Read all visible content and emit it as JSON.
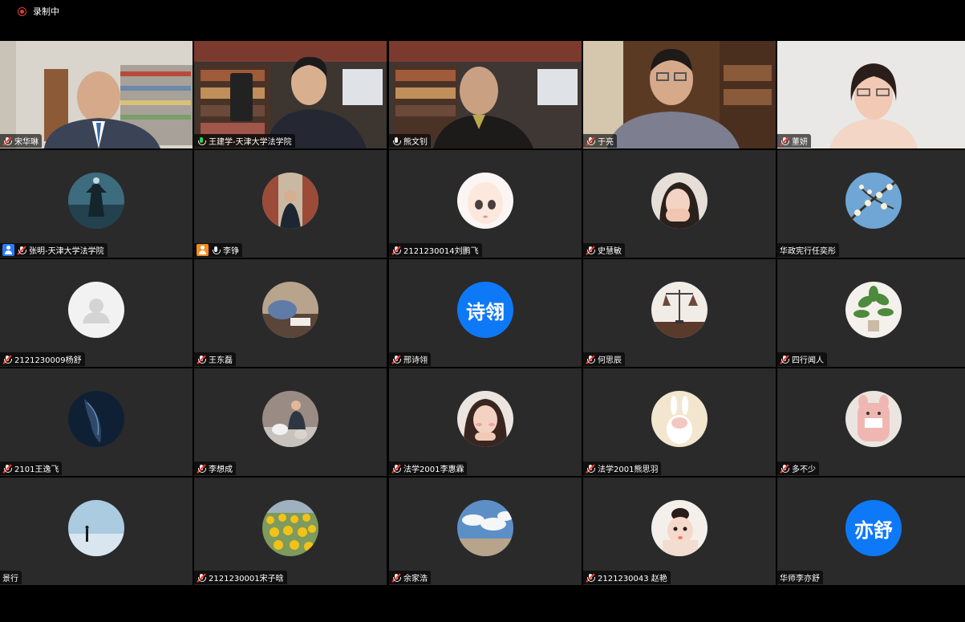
{
  "recording": {
    "label": "录制中"
  },
  "participants": [
    {
      "name": "宋华琳"
    },
    {
      "name": "王建学-天津大学法学院"
    },
    {
      "name": "熊文钊"
    },
    {
      "name": "于亮"
    },
    {
      "name": "董妍"
    },
    {
      "name": "张明-天津大学法学院"
    },
    {
      "name": "李铮"
    },
    {
      "name": "2121230014刘鹏飞"
    },
    {
      "name": "史慧敏"
    },
    {
      "name": "华政宪行任奕彤"
    },
    {
      "name": "2121230009杨舒"
    },
    {
      "name": "王东磊"
    },
    {
      "name": "邢诗翎",
      "avatar_text": "诗翎"
    },
    {
      "name": "何思辰"
    },
    {
      "name": "四行闻人"
    },
    {
      "name": "2101王逸飞"
    },
    {
      "name": "李想成"
    },
    {
      "name": "法学2001李惠霖"
    },
    {
      "name": "法学2001熊思羽"
    },
    {
      "name": "多不少"
    },
    {
      "name": "景行"
    },
    {
      "name": "2121230001宋子晗"
    },
    {
      "name": "余家浩"
    },
    {
      "name": "2121230043 赵艳"
    },
    {
      "name": "华师李亦舒",
      "avatar_text": "亦舒"
    }
  ],
  "colors": {
    "avatar_blue": "#0e79f7",
    "speaking_border": "#23c24a",
    "muted_red": "#ff3b30"
  }
}
